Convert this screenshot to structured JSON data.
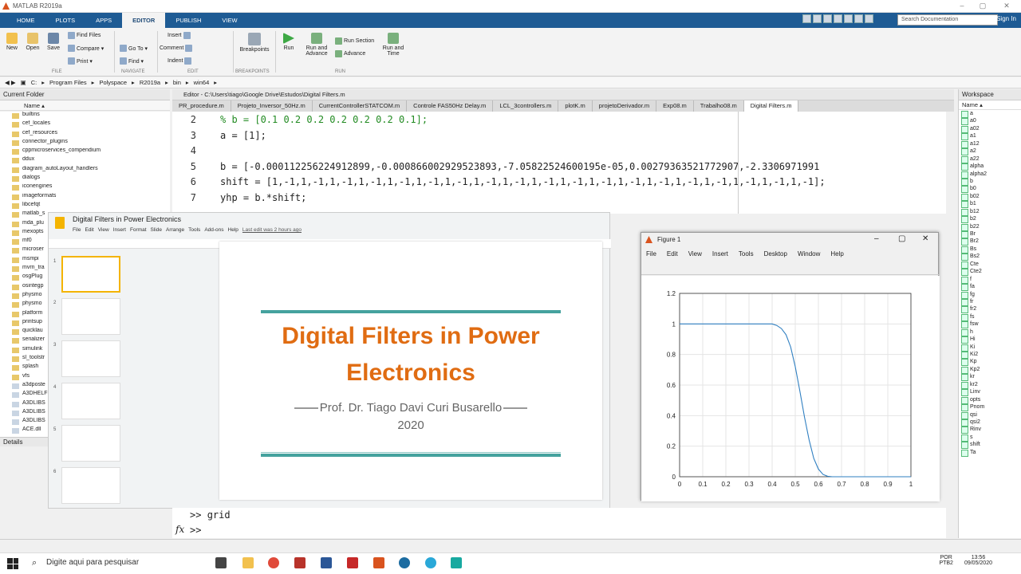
{
  "app": {
    "title": "MATLAB R2019a",
    "signin": "Sign In",
    "search_placeholder": "Search Documentation"
  },
  "ribbon": {
    "tabs": [
      "HOME",
      "PLOTS",
      "APPS",
      "EDITOR",
      "PUBLISH",
      "VIEW"
    ],
    "file": {
      "new": "New",
      "open": "Open",
      "save": "Save",
      "find_files": "Find Files",
      "compare": "Compare ▾",
      "print": "Print ▾",
      "group": "FILE"
    },
    "navigate": {
      "goto": "Go To ▾",
      "find": "Find ▾",
      "group": "NAVIGATE"
    },
    "edit": {
      "insert": "Insert",
      "comment": "Comment",
      "indent": "Indent",
      "group": "EDIT"
    },
    "breakpoints": {
      "label": "Breakpoints",
      "group": "BREAKPOINTS"
    },
    "run": {
      "run": "Run",
      "run_advance": "Run and Advance",
      "run_section": "Run Section",
      "advance": "Advance",
      "run_time": "Run and Time",
      "group": "RUN"
    }
  },
  "address": {
    "path": [
      "C:",
      "Program Files",
      "Polyspace",
      "R2019a",
      "bin",
      "win64"
    ]
  },
  "current_folder": {
    "title": "Current Folder",
    "col": "Name ▴",
    "details": "Details",
    "items": [
      {
        "n": "builtins",
        "t": "d"
      },
      {
        "n": "cef_locales",
        "t": "d"
      },
      {
        "n": "cef_resources",
        "t": "d"
      },
      {
        "n": "connector_plugins",
        "t": "d"
      },
      {
        "n": "cppmicroservices_compendium",
        "t": "d"
      },
      {
        "n": "ddux",
        "t": "d"
      },
      {
        "n": "diagram_autoLayout_handlers",
        "t": "d"
      },
      {
        "n": "dialogs",
        "t": "d"
      },
      {
        "n": "iconengines",
        "t": "d"
      },
      {
        "n": "imageformats",
        "t": "d"
      },
      {
        "n": "libcefqt",
        "t": "d"
      },
      {
        "n": "matlab_s",
        "t": "d"
      },
      {
        "n": "mda_plu",
        "t": "d"
      },
      {
        "n": "mexopts",
        "t": "d"
      },
      {
        "n": "mf0",
        "t": "d"
      },
      {
        "n": "microser",
        "t": "d"
      },
      {
        "n": "msmpi",
        "t": "d"
      },
      {
        "n": "mvrn_tra",
        "t": "d"
      },
      {
        "n": "osgPlug",
        "t": "d"
      },
      {
        "n": "osintegp",
        "t": "d"
      },
      {
        "n": "physmo",
        "t": "d"
      },
      {
        "n": "physmo",
        "t": "d"
      },
      {
        "n": "platform",
        "t": "d"
      },
      {
        "n": "printsup",
        "t": "d"
      },
      {
        "n": "quicklau",
        "t": "d"
      },
      {
        "n": "serializer",
        "t": "d"
      },
      {
        "n": "simulink",
        "t": "d"
      },
      {
        "n": "sl_toolstr",
        "t": "d"
      },
      {
        "n": "splash",
        "t": "d"
      },
      {
        "n": "vfs",
        "t": "d"
      },
      {
        "n": "a3dposte",
        "t": "f"
      },
      {
        "n": "A3DHELF",
        "t": "f"
      },
      {
        "n": "A3DLIBS",
        "t": "f"
      },
      {
        "n": "A3DLIBS",
        "t": "f"
      },
      {
        "n": "A3DLIBS",
        "t": "f"
      },
      {
        "n": "ACE.dll",
        "t": "f"
      }
    ]
  },
  "editor": {
    "title": "Editor - C:\\Users\\tiago\\Google Drive\\Estudos\\Digital Filters.m",
    "tabs": [
      "PR_procedure.m",
      "Projeto_Inversor_50Hz.m",
      "CurrentControllerSTATCOM.m",
      "Controle FAS50Hz Delay.m",
      "LCL_3controllers.m",
      "plotK.m",
      "projetoDerivador.m",
      "Exp08.m",
      "Trabalho08.m",
      "Digital Filters.m"
    ],
    "active_tab": 9,
    "lines": [
      {
        "n": "2",
        "code": "% b = [0.1 0.2 0.2 0.2 0.2 0.2 0.1];",
        "comment": true
      },
      {
        "n": "3",
        "code": "a = [1];",
        "comment": false
      },
      {
        "n": "4",
        "code": "",
        "comment": false
      },
      {
        "n": "5",
        "code": "b = [-0.000112256224912899,-0.000866002929523893,-7.05822524600195e-05,0.00279363521772907,-2.3306971991",
        "comment": false
      },
      {
        "n": "6",
        "code": "shift = [1,-1,1,-1,1,-1,1,-1,1,-1,1,-1,1,-1,1,-1,1,-1,1,-1,1,-1,1,-1,1,-1,1,-1,1,-1,1,-1,1,-1,1,-1,1,-1];",
        "comment": false
      },
      {
        "n": "7",
        "code": "yhp = b.*shift;",
        "comment": false
      }
    ]
  },
  "slides": {
    "doc_title": "Digital Filters in Power Electronics",
    "menu": [
      "File",
      "Edit",
      "View",
      "Insert",
      "Format",
      "Slide",
      "Arrange",
      "Tools",
      "Add-ons",
      "Help",
      "Last edit was 2 hours ago"
    ],
    "title": "Digital Filters in Power Electronics",
    "subtitle": "Prof. Dr. Tiago Davi Curi Busarello",
    "year": "2020",
    "thumb_numbers": [
      "1",
      "2",
      "3",
      "4",
      "5",
      "6"
    ]
  },
  "figure": {
    "title": "Figure 1",
    "menu": [
      "File",
      "Edit",
      "View",
      "Insert",
      "Tools",
      "Desktop",
      "Window",
      "Help"
    ],
    "plot": {
      "ytick": [
        "0",
        "0.2",
        "0.4",
        "0.6",
        "0.8",
        "1",
        "1.2"
      ],
      "xtick": [
        "0",
        "0.1",
        "0.2",
        "0.3",
        "0.4",
        "0.5",
        "0.6",
        "0.7",
        "0.8",
        "0.9",
        "1"
      ]
    }
  },
  "chart_data": {
    "type": "line",
    "xlim": [
      0,
      1
    ],
    "ylim": [
      0,
      1.2
    ],
    "grid": true,
    "color": "#2f7fc1",
    "series": [
      {
        "x": [
          0,
          0.35,
          0.4,
          0.42,
          0.44,
          0.46,
          0.48,
          0.5,
          0.52,
          0.54,
          0.56,
          0.58,
          0.6,
          0.62,
          0.64,
          0.66,
          0.7,
          1
        ],
        "y": [
          1,
          1,
          1,
          0.99,
          0.97,
          0.93,
          0.85,
          0.72,
          0.56,
          0.39,
          0.24,
          0.12,
          0.05,
          0.015,
          0.003,
          0,
          0,
          0
        ]
      }
    ]
  },
  "command": {
    "prompt": ">>",
    "history": "grid",
    "fx": "fx"
  },
  "workspace": {
    "title": "Workspace",
    "col": "Name ▴",
    "vars": [
      "a",
      "a0",
      "a02",
      "a1",
      "a12",
      "a2",
      "a22",
      "alpha",
      "alpha2",
      "b",
      "b0",
      "b02",
      "b1",
      "b12",
      "b2",
      "b22",
      "Br",
      "Br2",
      "Bs",
      "Bs2",
      "Cte",
      "Cte2",
      "f",
      "fa",
      "fg",
      "fr",
      "fr2",
      "fs",
      "fsw",
      "h",
      "Hi",
      "Ki",
      "Ki2",
      "Kp",
      "Kp2",
      "kr",
      "kr2",
      "Linv",
      "opts",
      "Pnom",
      "qsi",
      "qsi2",
      "Rinv",
      "s",
      "shift",
      "Ta"
    ]
  },
  "taskbar": {
    "search": "Digite aqui para pesquisar",
    "lang1": "POR",
    "lang2": "PTB2",
    "time": "13:56",
    "date": "09/05/2020"
  },
  "colors": {
    "ribbon": "#1e5b94",
    "accent_orange": "#e06c12",
    "teal": "#45a29e"
  }
}
